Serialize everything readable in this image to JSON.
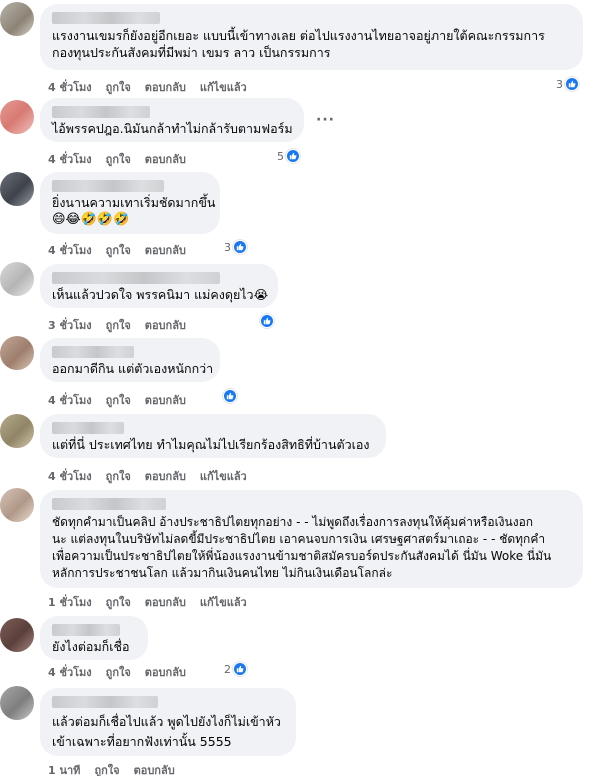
{
  "labels": {
    "like": "ถูกใจ",
    "reply": "ตอบกลับ",
    "edited": "แก้ไขแล้ว"
  },
  "colors": {
    "bubble": "#f0f2f5",
    "meta_text": "#65676b",
    "like_blue": "#1877f2"
  },
  "comments": [
    {
      "lines": [
        "แรงงานเขมรก็ยังอยู่อีกเยอะ แบบนี้เข้าทางเลย ต่อไปแรงงานไทยอาจอยู่ภายใต้คณะกรรมการ",
        "กองทุนประกันสังคมที่มีพม่า เขมร ลาว เป็นกรรมการ"
      ],
      "time": "4 ชั่วโมง",
      "edited": true,
      "likes": "3",
      "icon": "like-icon"
    },
    {
      "lines": [
        "ไอ้พรรคปฎอ.นิมันกล้าทำไม่กล้ารับตามฟอร์ม"
      ],
      "time": "4 ชั่วโมง",
      "edited": false,
      "likes": "5",
      "icon": "like-icon",
      "more": "···"
    },
    {
      "lines": [
        "ยิ่งนานความเทาเริ่มชัดมากขึ้น"
      ],
      "emojis": "😄😂🤣🤣🤣",
      "time": "4 ชั่วโมง",
      "edited": false,
      "likes": "3",
      "icon": "like-icon"
    },
    {
      "lines": [
        "เห็นแล้วปวดใจ พรรคนิมา แม่คงดุยไว😭"
      ],
      "time": "3 ชั่วโมง",
      "edited": false,
      "likes": "",
      "icon": "like-icon"
    },
    {
      "lines": [
        "ออกมาดีกิน แต่ตัวเองหนักกว่า"
      ],
      "time": "4 ชั่วโมง",
      "edited": false,
      "likes": "",
      "icon": "like-icon"
    },
    {
      "lines": [
        "แต่ที่นี่ ประเทศไทย ทำไมคุณไม่ไปเรียกร้องสิทธิที่บ้านตัวเอง"
      ],
      "time": "4 ชั่วโมง",
      "edited": true,
      "likes": "",
      "icon": ""
    },
    {
      "lines": [
        "ชัดทุกคำมาเป็นคลิป อ้างประชาธิปไตยทุกอย่าง - - ไม่พูดถึงเรื่องการลงทุนให้คุ้มค่าหรือเงินงอก",
        "นะ แต่ลงทุนในบริษัทไม่ลดขี้มีประชาธิปไตย เอาคนจบการเงิน เศรษฐศาสตร์มาเถอะ - - ชัดทุกคำ",
        "เพื่อความเป็นประชาธิปไตยให้พี่น้องแรงงานข้ามชาติสมัครบอร์ดประกันสังคมได้ นี่มัน Woke นี่มัน",
        "หลักการประชาชนโลก แล้วมากินเงินคนไทย ไม่กินเงินเดือนโลกล่ะ"
      ],
      "time": "1 ชั่วโมง",
      "edited": true,
      "likes": "",
      "icon": ""
    },
    {
      "lines": [
        "ยังไงต่อมก็เชื่อ"
      ],
      "time": "4 ชั่วโมง",
      "edited": false,
      "likes": "2",
      "icon": "like-icon"
    },
    {
      "lines": [
        "แล้วต่อมก็เชื่อไปแล้ว พูดไปยังไงก็ไม่เข้าหัว",
        "เข้าเฉพาะที่อยากฟังเท่านั้น 5555"
      ],
      "time": "1 นาที",
      "edited": false,
      "likes": "",
      "icon": ""
    }
  ]
}
